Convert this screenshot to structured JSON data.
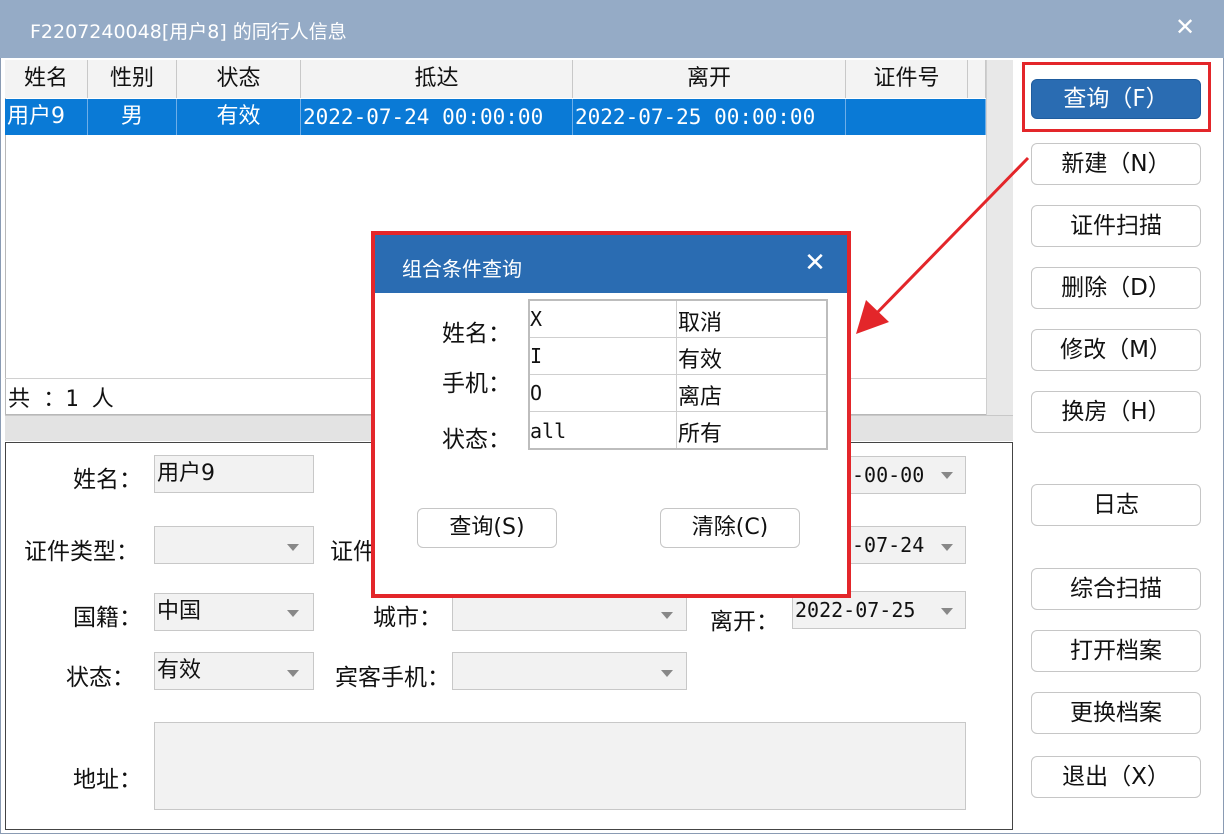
{
  "window": {
    "title": "F2207240048[用户8] 的同行人信息",
    "close_glyph": "✕"
  },
  "grid": {
    "columns": [
      "姓名",
      "性别",
      "状态",
      "抵达",
      "离开",
      "证件号"
    ],
    "rows": [
      {
        "name": "用户9",
        "gender": "男",
        "status": "有效",
        "arrive": "2022-07-24 00:00:00",
        "leave": "2022-07-25 00:00:00",
        "id": ""
      }
    ],
    "count_text": "共  ：1 人"
  },
  "form": {
    "name_label": "姓名：",
    "name_value": "用户9",
    "id_type_label": "证件类型：",
    "id_type_value": "",
    "id_no_label_partial": "证件",
    "nationality_label": "国籍：",
    "nationality_value": "中国",
    "city_label": "城市：",
    "city_value": "",
    "status_label": "状态：",
    "status_value": "有效",
    "phone_label": "宾客手机：",
    "phone_value": "",
    "address_label": "地址：",
    "address_value": "",
    "right_field_1": "-00-00",
    "right_field_2": "-07-24",
    "leave_label": "离开：",
    "leave_value": "2022-07-25"
  },
  "buttons": {
    "query": "查询（F）",
    "new": "新建（N）",
    "scan_id": "证件扫描",
    "delete": "删除（D）",
    "modify": "修改（M）",
    "change_room": "换房（H）",
    "log": "日志",
    "combined_scan": "综合扫描",
    "open_file": "打开档案",
    "replace_file": "更换档案",
    "exit": "退出（X）"
  },
  "popup": {
    "title": "组合条件查询",
    "close_glyph": "✕",
    "labels": {
      "name": "姓名：",
      "phone": "手机：",
      "status": "状态："
    },
    "options": [
      {
        "key": "X",
        "value": "取消"
      },
      {
        "key": "I",
        "value": "有效"
      },
      {
        "key": "O",
        "value": "离店"
      },
      {
        "key": "all",
        "value": "所有"
      }
    ],
    "query_button": "查询(S)",
    "clear_button": "清除(C)"
  },
  "colors": {
    "accent": "#2a6cb2",
    "selection": "#0a7ad6",
    "highlight": "#e3262a",
    "titlebar": "#95abc6"
  }
}
